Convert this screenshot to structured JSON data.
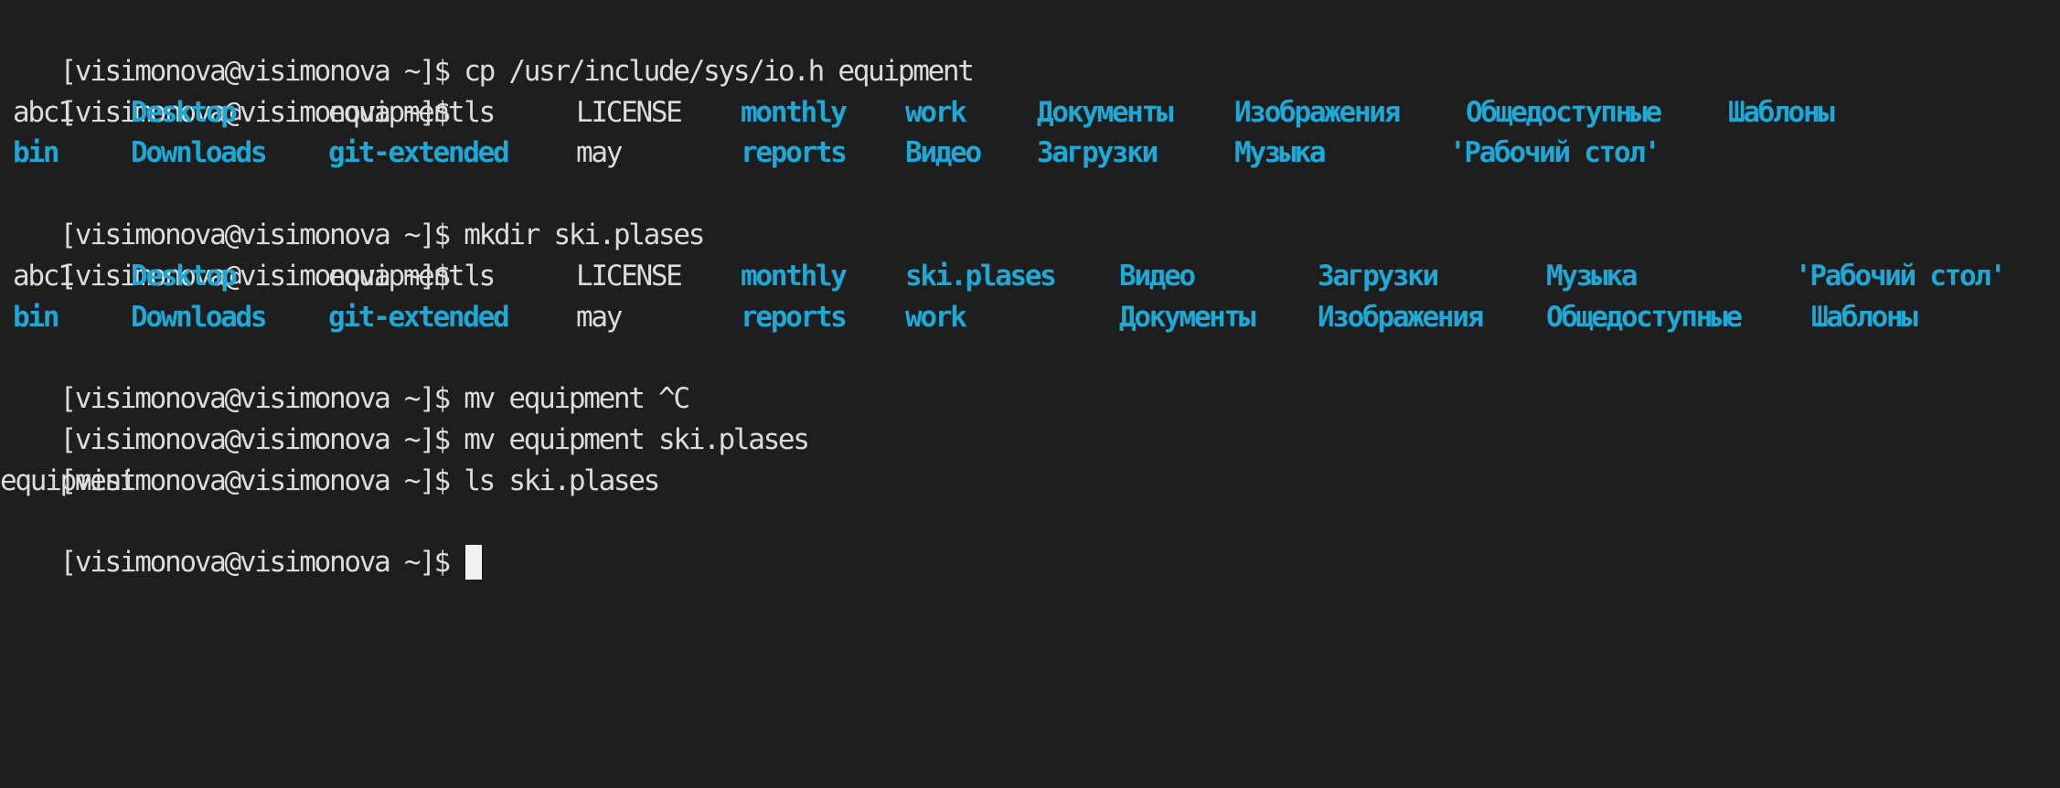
{
  "colors": {
    "background": "#1e1e1e",
    "text": "#dcdcdc",
    "directory": "#1ea8d6",
    "cursor": "#f2f2f2"
  },
  "prompt": "[visimonova@visimonova ~]$ ",
  "commands": {
    "cp": "cp /usr/include/sys/io.h equipment",
    "ls1": "ls",
    "mkdir": "mkdir ski.plases",
    "ls2": "ls",
    "mv_cancel": "mv equipment ^C",
    "mv": "mv equipment ski.plases",
    "ls3": "ls ski.plases"
  },
  "listing1": {
    "row1": [
      "abc1",
      "Desktop",
      "equipment",
      "LICENSE",
      "monthly",
      "work",
      "Документы",
      "Изображения",
      "Общедоступные",
      "Шаблоны"
    ],
    "row2": [
      "bin",
      "Downloads",
      "git-extended",
      "may",
      "reports",
      "Видео",
      "Загрузки",
      "Музыка",
      "'Рабочий стол'"
    ]
  },
  "listing2": {
    "row1": [
      "abc1",
      "Desktop",
      "equipment",
      "LICENSE",
      "monthly",
      "ski.plases",
      "Видео",
      "Загрузки",
      "Музыка",
      "'Рабочий стол'"
    ],
    "row2": [
      "bin",
      "Downloads",
      "git-extended",
      "may",
      "reports",
      "work",
      "Документы",
      "Изображения",
      "Общедоступные",
      "Шаблоны"
    ]
  },
  "listing3": {
    "row1": [
      "equipment"
    ]
  }
}
